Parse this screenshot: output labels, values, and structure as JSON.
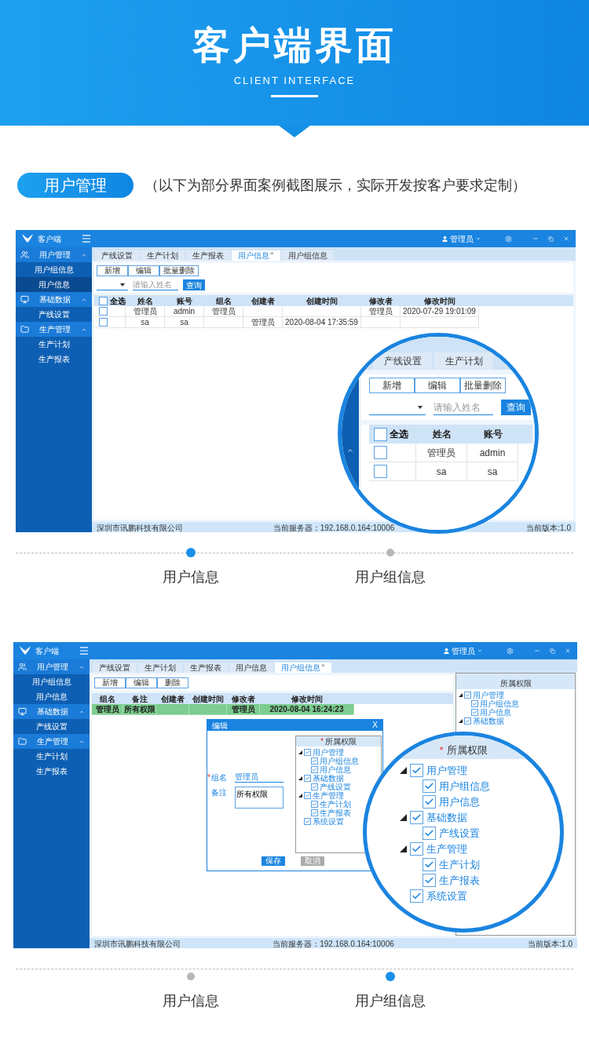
{
  "banner": {
    "title": "客户端界面",
    "subtitle": "CLIENT INTERFACE"
  },
  "section": {
    "badge": "用户管理",
    "note": "（以下为部分界面案例截图展示，实际开发按客户要求定制）"
  },
  "showcases": [
    {
      "app": {
        "title": "客户端",
        "user": "管理员",
        "sidebar": [
          {
            "label": "用户管理",
            "expanded": true,
            "children": [
              {
                "label": "用户组信息",
                "selected": false
              },
              {
                "label": "用户信息",
                "selected": true
              }
            ]
          },
          {
            "label": "基础数据",
            "expanded": true,
            "children": [
              {
                "label": "产线设置",
                "selected": false
              }
            ]
          },
          {
            "label": "生产管理",
            "expanded": true,
            "children": [
              {
                "label": "生产计划",
                "selected": false
              },
              {
                "label": "生产报表",
                "selected": false
              }
            ]
          }
        ],
        "tabs": [
          {
            "label": "产线设置",
            "selected": false
          },
          {
            "label": "生产计划",
            "selected": false
          },
          {
            "label": "生产报表",
            "selected": false
          },
          {
            "label": "用户信息",
            "selected": true,
            "close": "×"
          },
          {
            "label": "用户组信息",
            "selected": false
          }
        ],
        "toolbar": [
          "新增",
          "编辑",
          "批量删除"
        ],
        "search": {
          "placeholder": "请输入姓名",
          "button": "查询"
        },
        "table": {
          "select_all": {
            "label": "全选",
            "checked": false
          },
          "columns": [
            "姓名",
            "账号",
            "组名",
            "创建者",
            "创建时间",
            "修改者",
            "修改时间"
          ],
          "rows": [
            {
              "checked": false,
              "selected": false,
              "cells": [
                "管理员",
                "admin",
                "管理员",
                null,
                null,
                "管理员",
                "2020-07-29 19:01:09"
              ]
            },
            {
              "checked": false,
              "selected": false,
              "cells": [
                "sa",
                "sa",
                null,
                "管理员",
                "2020-08-04 17:35:59",
                null,
                null
              ]
            }
          ]
        },
        "status_bar": [
          "深圳市讯鹏科技有限公司",
          "当前服务器：192.168.0.164:10006",
          "当前版本:1.0"
        ]
      },
      "magnifier": {
        "kind": "list",
        "tabs": [
          {
            "label": "产线设置",
            "selected": false
          },
          {
            "label": "生产计划",
            "selected": false
          }
        ],
        "toolbar": [
          "新增",
          "编辑",
          "批量删除"
        ],
        "search": {
          "placeholder": "请输入姓名",
          "button": "查询"
        },
        "table": {
          "select_all": {
            "label": "全选",
            "checked": false
          },
          "columns": [
            "姓名",
            "账号"
          ],
          "rows": [
            {
              "checked": false,
              "cells": [
                "管理员",
                "admin"
              ]
            },
            {
              "checked": false,
              "cells": [
                "sa",
                "sa"
              ]
            }
          ]
        }
      },
      "pager": [
        {
          "label": "用户信息",
          "selected": true
        },
        {
          "label": "用户组信息",
          "selected": false
        }
      ]
    },
    {
      "app": {
        "title": "客户端",
        "user": "管理员",
        "sidebar": [
          {
            "label": "用户管理",
            "expanded": true,
            "children": [
              {
                "label": "用户组信息",
                "selected": false
              },
              {
                "label": "用户信息",
                "selected": false
              }
            ]
          },
          {
            "label": "基础数据",
            "expanded": true,
            "children": [
              {
                "label": "产线设置",
                "selected": false
              }
            ]
          },
          {
            "label": "生产管理",
            "expanded": true,
            "children": [
              {
                "label": "生产计划",
                "selected": false
              },
              {
                "label": "生产报表",
                "selected": false
              }
            ]
          }
        ],
        "tabs": [
          {
            "label": "产线设置",
            "selected": false
          },
          {
            "label": "生产计划",
            "selected": false
          },
          {
            "label": "生产报表",
            "selected": false
          },
          {
            "label": "用户信息",
            "selected": false
          },
          {
            "label": "用户组信息",
            "selected": true,
            "close": "×"
          }
        ],
        "toolbar": [
          "新增",
          "编辑",
          "删除"
        ],
        "table": {
          "columns": [
            "组名",
            "备注",
            "创建者",
            "创建时间",
            "修改者",
            "修改时间"
          ],
          "rows": [
            {
              "selected": true,
              "cells": [
                "管理员",
                "所有权限",
                null,
                null,
                "管理员",
                "2020-08-04 16:24:23"
              ]
            }
          ]
        },
        "side_panel": {
          "title": "所属权限",
          "tree": [
            {
              "label": "用户管理",
              "checked": true,
              "expanded": true,
              "children": [
                {
                  "label": "用户组信息",
                  "checked": true
                },
                {
                  "label": "用户信息",
                  "checked": true
                }
              ]
            },
            {
              "label": "基础数据",
              "checked": true,
              "expanded": true
            }
          ]
        },
        "dialog": {
          "title": "编辑",
          "close": "X",
          "fields": [
            {
              "kind": "input",
              "required_mark": "*",
              "label": "组名",
              "value": "管理员"
            },
            {
              "kind": "textarea",
              "label": "备注",
              "value": "所有权限"
            }
          ],
          "panel": {
            "required_mark": "*",
            "title": "所属权限",
            "tree": [
              {
                "label": "用户管理",
                "checked": true,
                "expanded": true,
                "children": [
                  {
                    "label": "用户组信息",
                    "checked": true
                  },
                  {
                    "label": "用户信息",
                    "checked": true
                  }
                ]
              },
              {
                "label": "基础数据",
                "checked": true,
                "expanded": true,
                "children": [
                  {
                    "label": "产线设置",
                    "checked": true
                  }
                ]
              },
              {
                "label": "生产管理",
                "checked": true,
                "expanded": true,
                "children": [
                  {
                    "label": "生产计划",
                    "checked": true
                  },
                  {
                    "label": "生产报表",
                    "checked": true
                  }
                ]
              },
              {
                "label": "系统设置",
                "checked": true
              }
            ]
          },
          "buttons": [
            {
              "kind": "primary",
              "label": "保存"
            },
            {
              "kind": "secondary",
              "label": "取消"
            }
          ]
        },
        "status_bar": [
          "深圳市讯鹏科技有限公司",
          "当前服务器：192.168.0.164:10006",
          "当前版本:1.0"
        ]
      },
      "magnifier": {
        "kind": "tree",
        "panel": {
          "required_mark": "*",
          "title": "所属权限",
          "tree": [
            {
              "label": "用户管理",
              "checked": true,
              "expanded": true,
              "children": [
                {
                  "label": "用户组信息",
                  "checked": true
                },
                {
                  "label": "用户信息",
                  "checked": true
                }
              ]
            },
            {
              "label": "基础数据",
              "checked": true,
              "expanded": true,
              "children": [
                {
                  "label": "产线设置",
                  "checked": true
                }
              ]
            },
            {
              "label": "生产管理",
              "checked": true,
              "expanded": true,
              "children": [
                {
                  "label": "生产计划",
                  "checked": true
                },
                {
                  "label": "生产报表",
                  "checked": true
                }
              ]
            },
            {
              "label": "系统设置",
              "checked": true
            }
          ]
        }
      },
      "pager": [
        {
          "label": "用户信息",
          "selected": false
        },
        {
          "label": "用户组信息",
          "selected": true
        }
      ]
    }
  ]
}
